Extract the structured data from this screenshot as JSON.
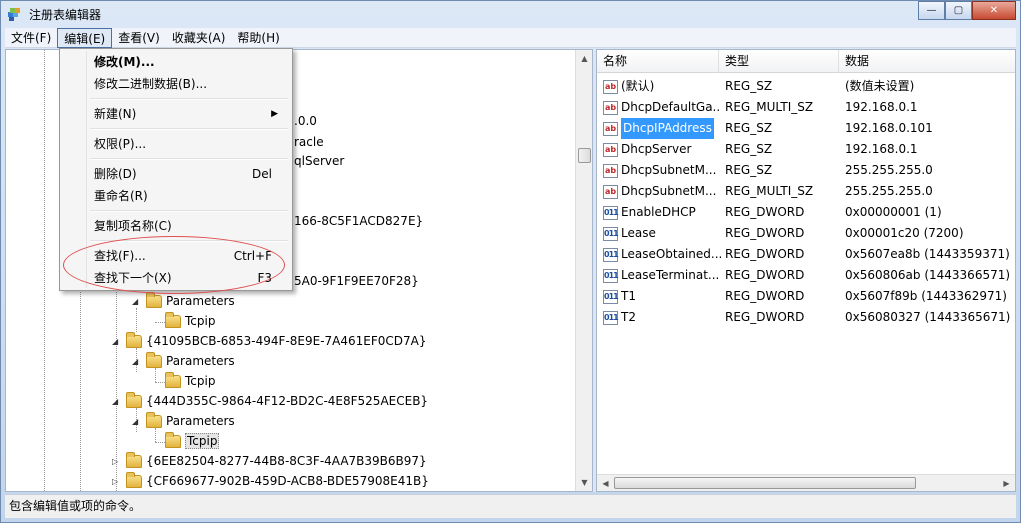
{
  "window": {
    "title": "注册表编辑器",
    "controls": {
      "minimize": "—",
      "maximize": "▢",
      "close": "✕"
    }
  },
  "menubar": [
    "文件(F)",
    "编辑(E)",
    "查看(V)",
    "收藏夹(A)",
    "帮助(H)"
  ],
  "edit_menu": {
    "modify": "修改(M)...",
    "modify_binary": "修改二进制数据(B)...",
    "new": "新建(N)",
    "permissions": "权限(P)...",
    "delete": "删除(D)",
    "delete_shortcut": "Del",
    "rename": "重命名(R)",
    "copy_key_name": "复制项名称(C)",
    "find": "查找(F)...",
    "find_shortcut": "Ctrl+F",
    "find_next": "查找下一个(X)",
    "find_next_shortcut": "F3"
  },
  "tree": {
    "partial": [
      ".0.0",
      "racle",
      "qlServer",
      "166-8C5F1ACD827E}",
      "5A0-9F1F9EE70F28}"
    ],
    "nodes": [
      "Parameters",
      "Tcpip",
      "{41095BCB-6853-494F-8E9E-7A461EF0CD7A}",
      "Parameters",
      "Tcpip",
      "{444D355C-9864-4F12-BD2C-4E8F525AECEB}",
      "Parameters",
      "Tcpip",
      "{6EE82504-8277-44B8-8C3F-4AA7B39B6B97}",
      "{CF669677-902B-459D-ACB8-BDE57908E41B}"
    ]
  },
  "columns": {
    "name": "名称",
    "type": "类型",
    "data": "数据"
  },
  "values": [
    {
      "name": "(默认)",
      "type": "REG_SZ",
      "data": "(数值未设置)",
      "icon": "ab"
    },
    {
      "name": "DhcpDefaultGa...",
      "type": "REG_MULTI_SZ",
      "data": "192.168.0.1",
      "icon": "ab"
    },
    {
      "name": "DhcpIPAddress",
      "type": "REG_SZ",
      "data": "192.168.0.101",
      "icon": "ab"
    },
    {
      "name": "DhcpServer",
      "type": "REG_SZ",
      "data": "192.168.0.1",
      "icon": "ab"
    },
    {
      "name": "DhcpSubnetM...",
      "type": "REG_SZ",
      "data": "255.255.255.0",
      "icon": "ab"
    },
    {
      "name": "DhcpSubnetM...",
      "type": "REG_MULTI_SZ",
      "data": "255.255.255.0",
      "icon": "ab"
    },
    {
      "name": "EnableDHCP",
      "type": "REG_DWORD",
      "data": "0x00000001 (1)",
      "icon": "011"
    },
    {
      "name": "Lease",
      "type": "REG_DWORD",
      "data": "0x00001c20 (7200)",
      "icon": "011"
    },
    {
      "name": "LeaseObtained...",
      "type": "REG_DWORD",
      "data": "0x5607ea8b (1443359371)",
      "icon": "011"
    },
    {
      "name": "LeaseTerminat...",
      "type": "REG_DWORD",
      "data": "0x560806ab (1443366571)",
      "icon": "011"
    },
    {
      "name": "T1",
      "type": "REG_DWORD",
      "data": "0x5607f89b (1443362971)",
      "icon": "011"
    },
    {
      "name": "T2",
      "type": "REG_DWORD",
      "data": "0x56080327 (1443365671)",
      "icon": "011"
    }
  ],
  "status": "包含编辑值或项的命令。"
}
